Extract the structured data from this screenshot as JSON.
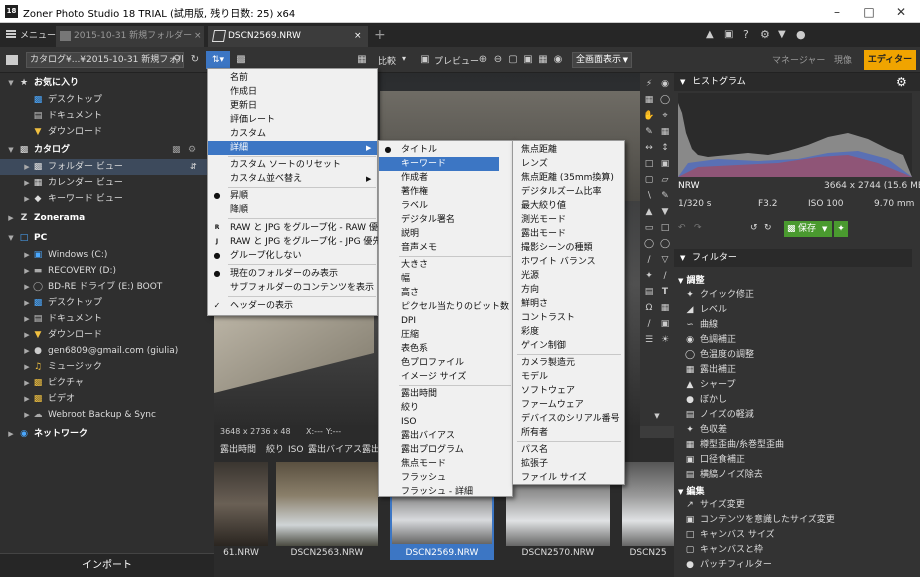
{
  "window": {
    "title": "Zoner Photo Studio 18 TRIAL (試用版, 残り日数: 25) x64",
    "app_icon": "18"
  },
  "tabs": {
    "menu_label": "メニュー",
    "tab1": "2015-10-31 新規フォルダー",
    "tab2": "DSCN2569.NRW"
  },
  "toolbar": {
    "path": "カタログ¥...¥2015-10-31 新規フォルダ...",
    "compare": "比較",
    "preview": "プレビュー",
    "fullscreen": "全画面表示",
    "modes": {
      "manager": "マネージャー",
      "viewer": "現像",
      "editor": "エディター"
    }
  },
  "sidebar": {
    "favorites": "お気に入り",
    "fav_items": [
      "デスクトップ",
      "ドキュメント",
      "ダウンロード"
    ],
    "catalog": "カタログ",
    "cat_items": [
      "フォルダー ビュー",
      "カレンダー ビュー",
      "キーワード ビュー"
    ],
    "zonerama": "Zonerama",
    "pc": "PC",
    "pc_items": [
      "Windows (C:)",
      "RECOVERY (D:)",
      "BD-RE ドライブ (E:) BOOT",
      "デスクトップ",
      "ドキュメント",
      "ダウンロード",
      "gen6809@gmail.com (giulia)",
      "ミュージック",
      "ピクチャ",
      "ビデオ",
      "Webroot Backup & Sync"
    ],
    "network": "ネットワーク",
    "import": "インポート"
  },
  "sort_menu": {
    "items": [
      "名前",
      "作成日",
      "更新日",
      "評価レート",
      "カスタム",
      "詳細",
      "カスタム ソートのリセット",
      "カスタム並べ替え",
      "昇順",
      "降順",
      "RAW と JPG をグループ化 - RAW 優先",
      "RAW と JPG をグループ化 - JPG 優先",
      "グループ化しない",
      "現在のフォルダーのみ表示",
      "サブフォルダーのコンテンツを表示",
      "ヘッダーの表示"
    ]
  },
  "detail_menu": {
    "items": [
      "タイトル",
      "キーワード",
      "作成者",
      "著作権",
      "ラベル",
      "デジタル署名",
      "説明",
      "音声メモ",
      "大きさ",
      "幅",
      "高さ",
      "ピクセル当たりのビット数",
      "DPI",
      "圧縮",
      "表色系",
      "色プロファイル",
      "イメージ サイズ",
      "露出時間",
      "絞り",
      "ISO",
      "露出バイアス",
      "露出プログラム",
      "焦点モード",
      "フラッシュ",
      "フラッシュ - 詳細"
    ]
  },
  "detail_menu2": {
    "items": [
      "焦点距離",
      "レンズ",
      "焦点距離 (35mm換算)",
      "デジタルズーム比率",
      "最大絞り値",
      "測光モード",
      "露出モード",
      "撮影シーンの種類",
      "ホワイト バランス",
      "光源",
      "方向",
      "鮮明さ",
      "コントラスト",
      "彩度",
      "ゲイン制御",
      "カメラ製造元",
      "モデル",
      "ソフトウェア",
      "ファームウェア",
      "デバイスのシリアル番号",
      "所有者",
      "パス名",
      "拡張子",
      "ファイル サイズ"
    ]
  },
  "photo_info": {
    "dims": "3648 x 2736 x 48",
    "x": "X:---",
    "y": "Y:---"
  },
  "filmstrip": {
    "columns": [
      "露出時間",
      "絞り",
      "ISO",
      "露出バイアス",
      "露出"
    ],
    "labels": [
      "61.NRW",
      "DSCN2563.NRW",
      "DSCN2569.NRW",
      "DSCN2570.NRW",
      "DSCN25"
    ]
  },
  "right": {
    "histogram": "ヒストグラム",
    "format": "NRW",
    "resolution": "3664 x 2744 (15.6 MB)",
    "shutter": "1/320 s",
    "aperture": "F3.2",
    "iso": "ISO 100",
    "focal": "9.70 mm",
    "save": "保存",
    "filters": "フィルター",
    "adjust": "調整",
    "adjust_items": [
      "クイック修正",
      "レベル",
      "曲線",
      "色調補正",
      "色温度の調整",
      "露出補正",
      "シャープ",
      "ぼかし",
      "ノイズの軽減",
      "色収差",
      "樽型歪曲/糸巻型歪曲",
      "口径食補正",
      "横縞ノイズ除去"
    ],
    "edit": "編集",
    "edit_items": [
      "サイズ変更",
      "コンテンツを意識したサイズ変更",
      "キャンバス サイズ",
      "キャンバスと枠",
      "パッチフィルター"
    ]
  },
  "colors": {
    "accent": "#f0a400",
    "highlight": "#3c76c4",
    "save": "#4a9a2f"
  }
}
